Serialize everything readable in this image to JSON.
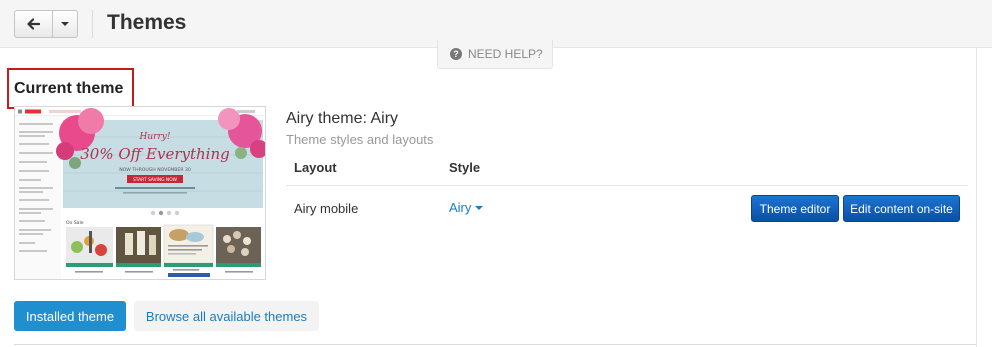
{
  "header": {
    "title": "Themes",
    "back_icon": "arrow-left-icon",
    "dropdown_icon": "caret-down-icon"
  },
  "help": {
    "label": "NEED HELP?",
    "icon": "question-circle-icon",
    "icon_glyph": "?"
  },
  "current_theme": {
    "section_title": "Current theme",
    "name": "Airy theme: Airy",
    "subtitle": "Theme styles and layouts",
    "table": {
      "headers": {
        "layout": "Layout",
        "style": "Style"
      },
      "rows": [
        {
          "layout": "Airy mobile",
          "style": "Airy"
        }
      ]
    },
    "buttons": {
      "editor": "Theme editor",
      "edit_onsite": "Edit content on-site"
    },
    "preview": {
      "banner": {
        "hurry": "Hurry!",
        "big": "30% Off Everything",
        "sub": "NOW THROUGH NOVEMBER 30",
        "cta": "START SAVING NOW"
      },
      "section_label": "On Sale"
    }
  },
  "tabs": {
    "installed": "Installed theme",
    "browse": "Browse all available themes"
  },
  "colors": {
    "primary_button": "#0b5cb8",
    "tab_active": "#1f8fd0",
    "link": "#1a7cc4",
    "highlight_box": "#c71b1b"
  }
}
